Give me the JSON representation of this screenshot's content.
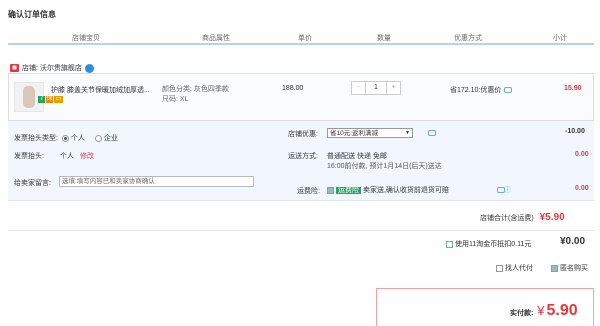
{
  "title": "确认订单信息",
  "columns": [
    "店铺宝贝",
    "商品属性",
    "单价",
    "数量",
    "优惠方式",
    "小计"
  ],
  "shop": {
    "name": "店铺: 沃尔贵旗舰店"
  },
  "item": {
    "name": "护膝 膝盖关节保暖加绒加厚透...",
    "attr_color": "颜色分类: 灰色四季款",
    "attr_size": "尺码: XL",
    "price": "188.00",
    "qty_minus": "-",
    "qty": "1",
    "qty_plus": "+",
    "promo": "省172.10:优惠价",
    "subtotal": "15.90"
  },
  "invoice": {
    "type_label": "发票抬头类型:",
    "opt_personal": "个人",
    "opt_company": "企业",
    "head_label": "发票抬头:",
    "head_value": "个人",
    "head_edit": "修改"
  },
  "shop_discount": {
    "label": "店铺优惠:",
    "selected": "省10元:返利满减",
    "amount": "-10.00"
  },
  "shipping": {
    "label": "运送方式:",
    "line1": "普通配送 快递 免邮",
    "line2": "16:00前付款, 预计1月14日(后天)送达",
    "amount": "0.00"
  },
  "message": {
    "label": "给卖家留言:",
    "placeholder": "选填:填写内容已和卖家协商确认"
  },
  "insurance": {
    "label": "运费险:",
    "tag": "运费险",
    "text": "卖家送,确认收货前退货可赔",
    "amount": "0.00"
  },
  "shop_total": {
    "label": "店铺合计(含运费)",
    "value": "¥5.90"
  },
  "coins": {
    "label": "使用11淘金币抵扣0.11元",
    "value": "¥0.00"
  },
  "options": {
    "proxy": "找人代付",
    "anonymous": "匿名购买"
  },
  "pay": {
    "label": "实付款:",
    "currency": "¥",
    "value": "5.90"
  },
  "colors": {
    "accent": "#e4393c",
    "header_border": "#b2d1ff",
    "detail_bg": "#f2f7ff"
  }
}
